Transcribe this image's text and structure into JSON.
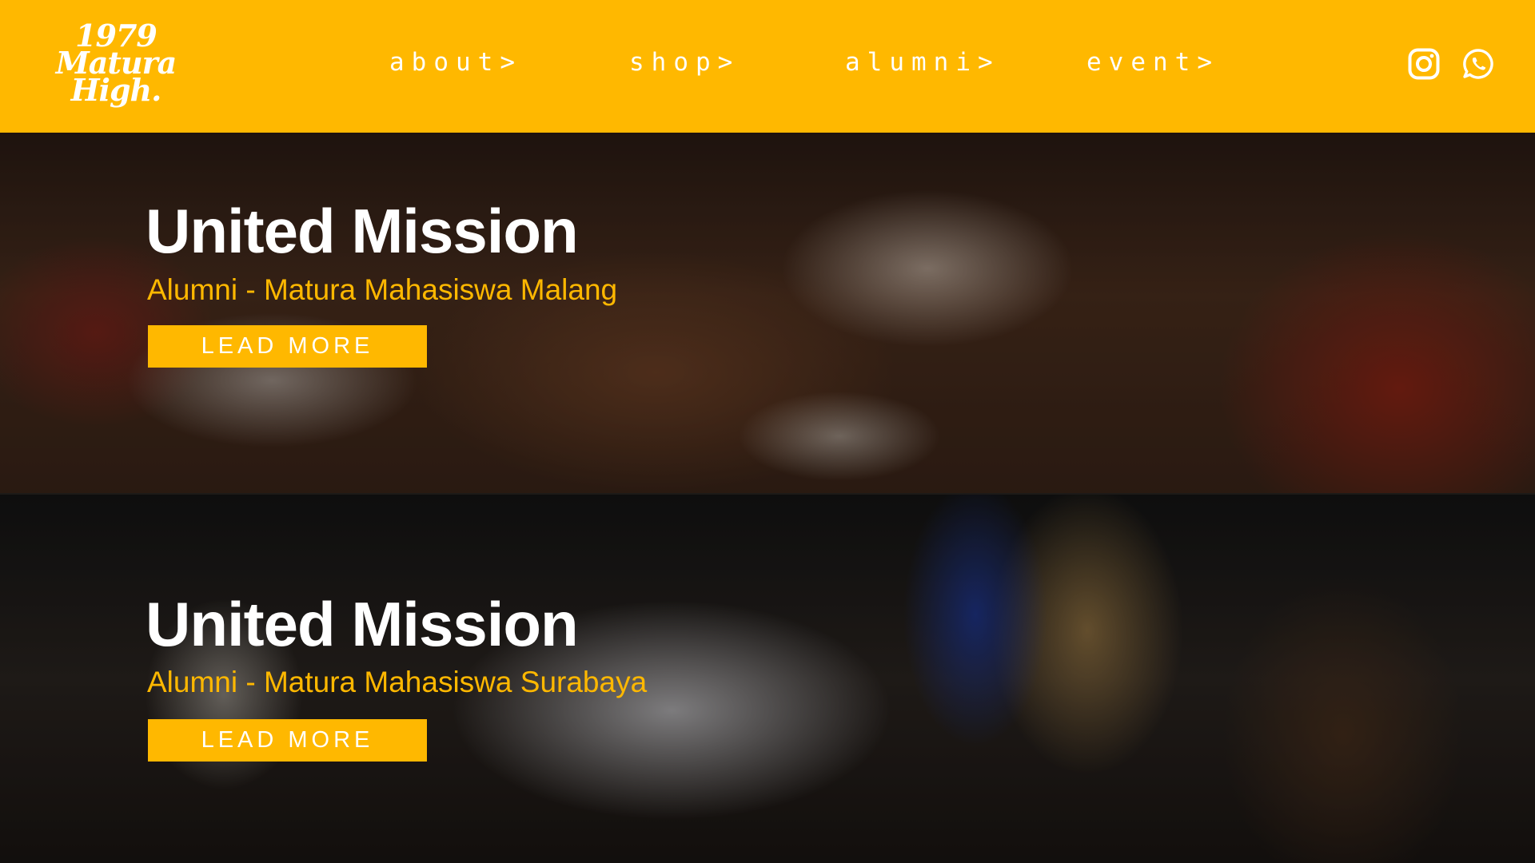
{
  "header": {
    "logo": {
      "line1": "1979",
      "line2": "Matura",
      "line3": "High."
    },
    "nav": {
      "about": "about>",
      "shop": "shop>",
      "alumni": "alumni>",
      "event": "event>"
    },
    "social": {
      "instagram_icon": "instagram-icon",
      "whatsapp_icon": "whatsapp-icon"
    },
    "background_color": "#FFB800"
  },
  "banners": [
    {
      "title": "United Mission",
      "subtitle": "Alumni - Matura Mahasiswa Malang",
      "button_label": "LEAD MORE"
    },
    {
      "title": "United Mission",
      "subtitle": "Alumni - Matura Mahasiswa Surabaya",
      "button_label": "LEAD MORE"
    }
  ],
  "colors": {
    "accent": "#FFB800",
    "text_light": "#FFFFFF"
  }
}
